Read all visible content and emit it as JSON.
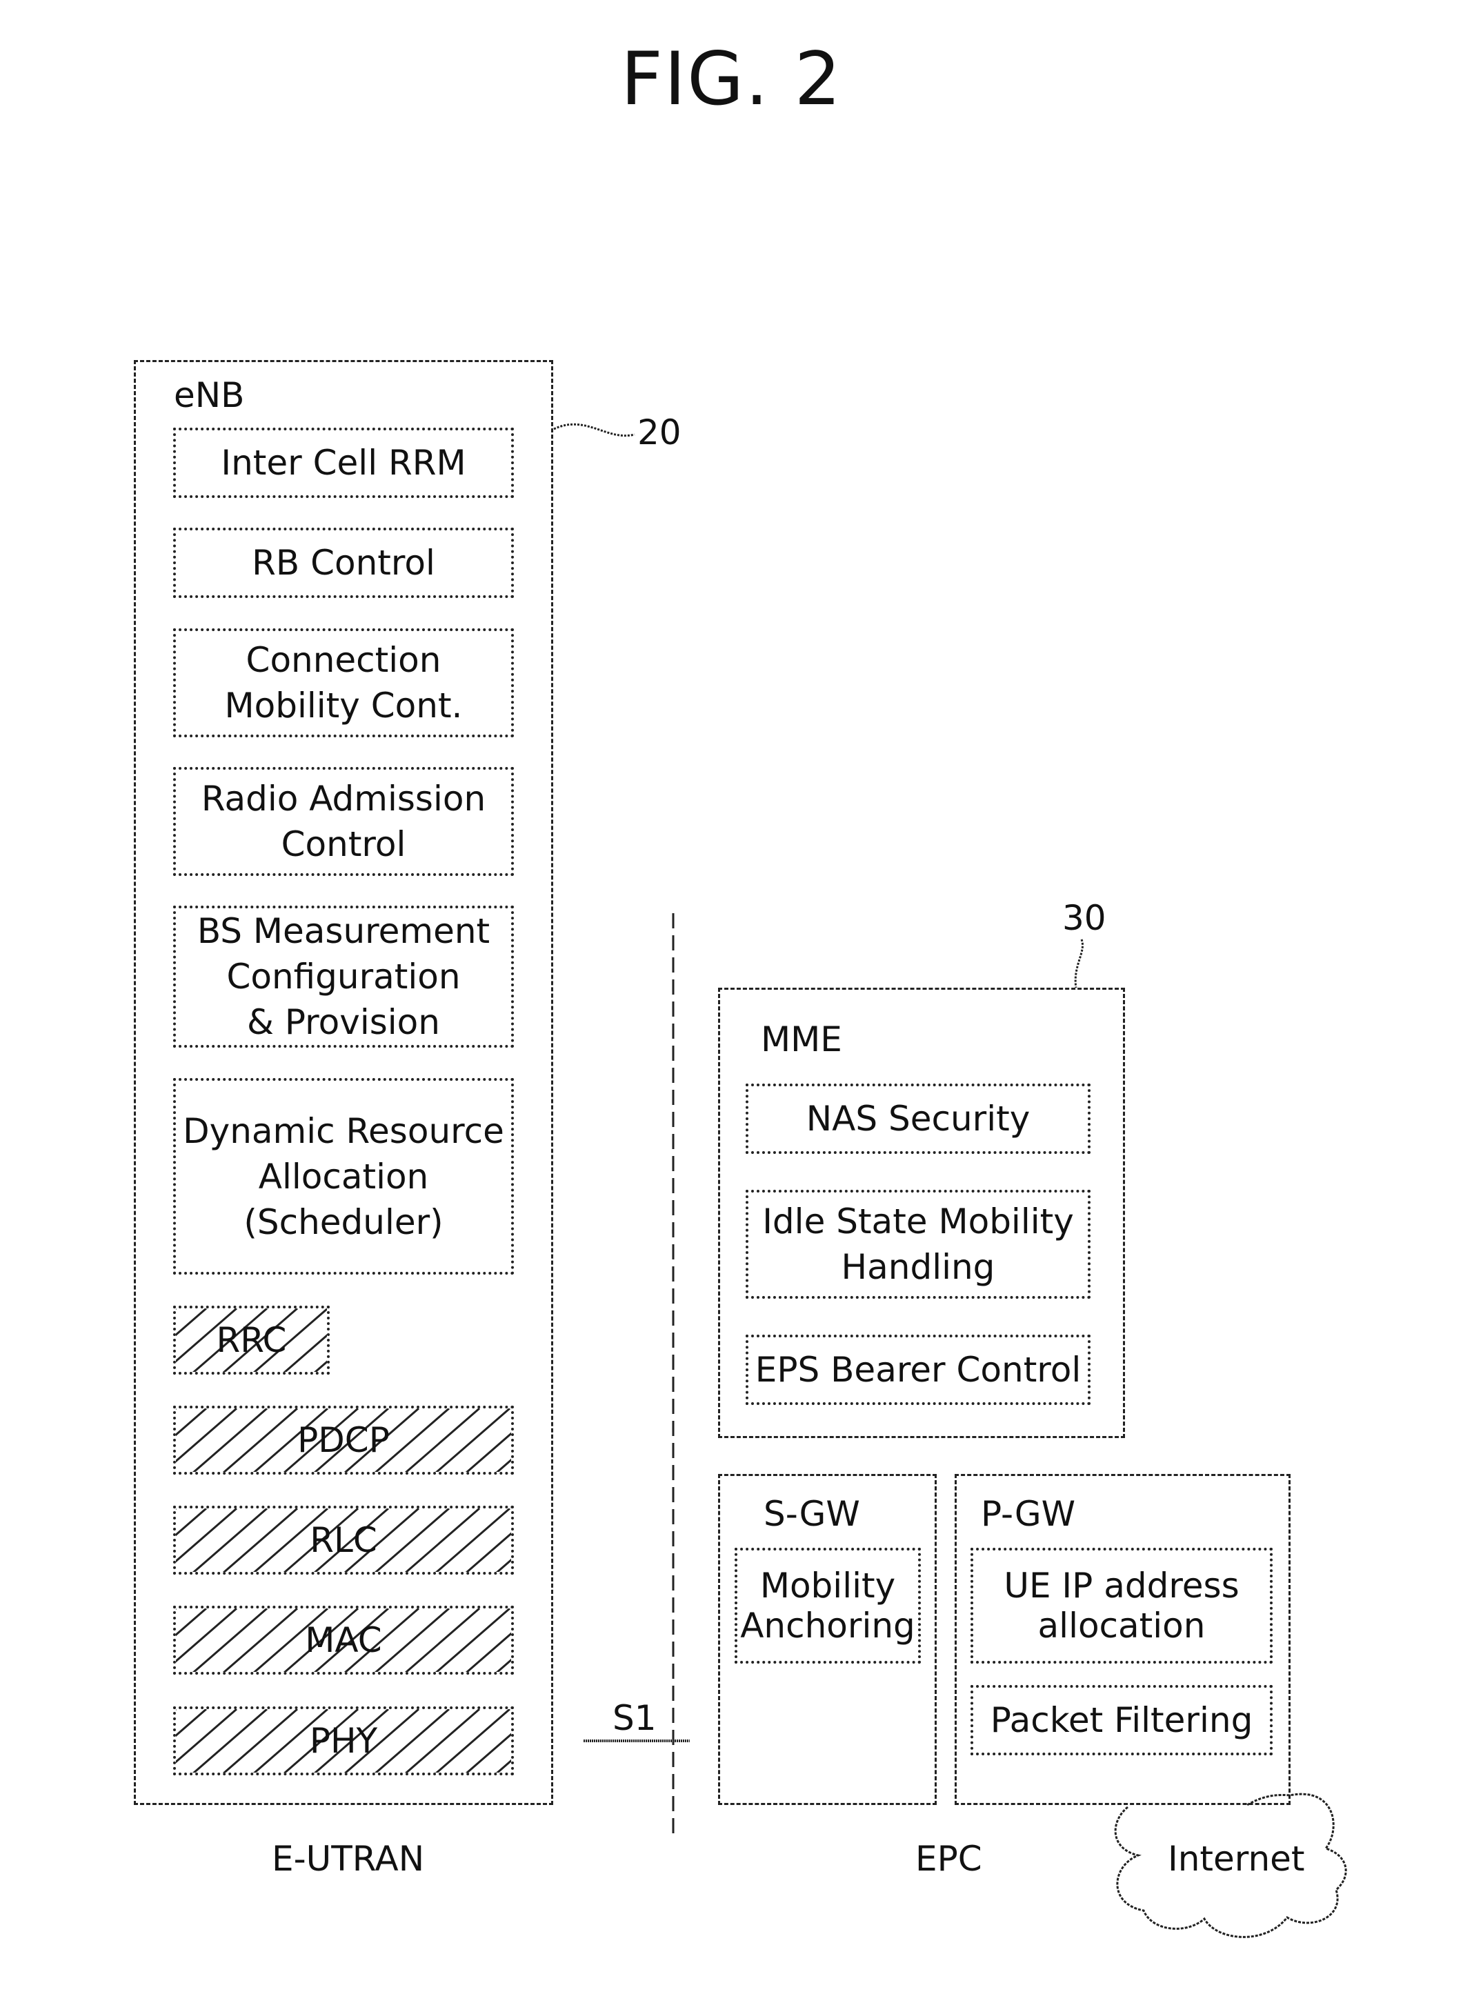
{
  "figure": {
    "title": "FIG. 2"
  },
  "enb": {
    "name": "eNB",
    "ref_numeral": "20",
    "functions": [
      {
        "lines": [
          "Inter Cell RRM"
        ]
      },
      {
        "lines": [
          "RB Control"
        ]
      },
      {
        "lines": [
          "Connection",
          "Mobility Cont."
        ]
      },
      {
        "lines": [
          "Radio Admission",
          "Control"
        ]
      },
      {
        "lines": [
          "BS Measurement",
          "Configuration",
          "& Provision"
        ]
      },
      {
        "lines": [
          "Dynamic Resource",
          "Allocation",
          "(Scheduler)"
        ]
      }
    ],
    "protocol_layers": [
      "RRC",
      "PDCP",
      "RLC",
      "MAC",
      "PHY"
    ],
    "region_label": "E-UTRAN"
  },
  "interface": {
    "label": "S1"
  },
  "mme": {
    "name": "MME",
    "ref_numeral": "30",
    "functions": [
      {
        "lines": [
          "NAS Security"
        ]
      },
      {
        "lines": [
          "Idle State Mobility",
          "Handling"
        ]
      },
      {
        "lines": [
          "EPS Bearer Control"
        ]
      }
    ]
  },
  "sgw": {
    "name": "S-GW",
    "functions": [
      {
        "lines": [
          "Mobility",
          "Anchoring"
        ]
      }
    ]
  },
  "pgw": {
    "name": "P-GW",
    "functions": [
      {
        "lines": [
          "UE IP address",
          "allocation"
        ]
      },
      {
        "lines": [
          "Packet Filtering"
        ]
      }
    ]
  },
  "epc": {
    "region_label": "EPC"
  },
  "internet": {
    "label": "Internet"
  }
}
